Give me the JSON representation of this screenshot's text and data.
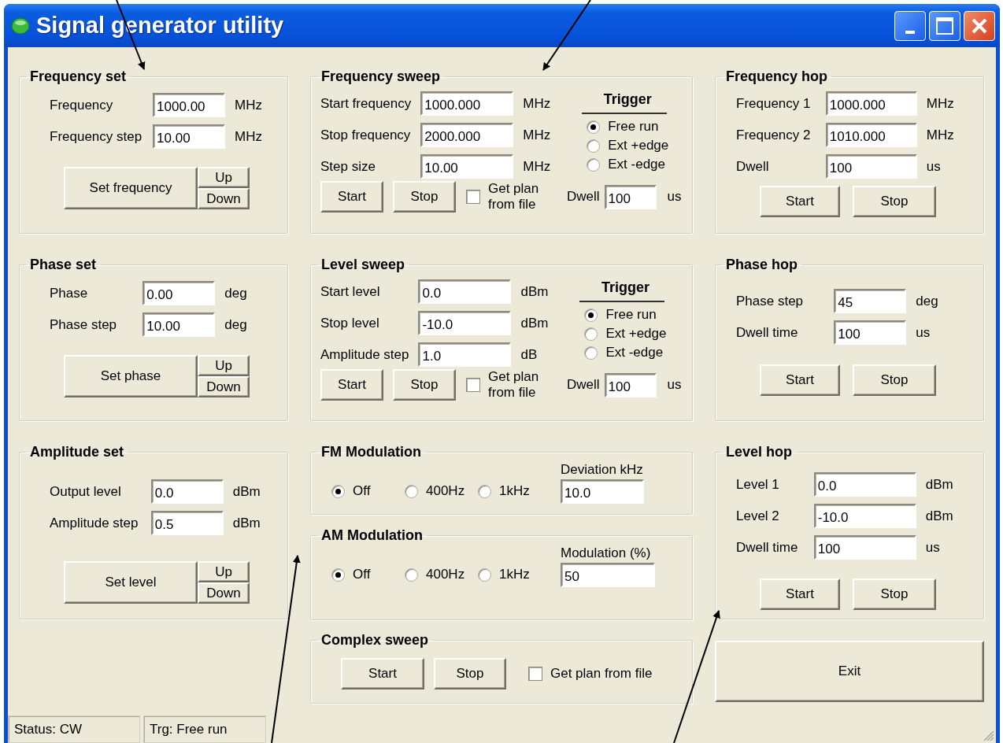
{
  "window": {
    "title": "Signal generator utility"
  },
  "frequency_set": {
    "title": "Frequency set",
    "fields": [
      {
        "label": "Frequency",
        "value": "1000.00",
        "unit": "MHz"
      },
      {
        "label": "Frequency step",
        "value": "10.00",
        "unit": "MHz"
      }
    ],
    "set_button": "Set frequency",
    "up_button": "Up",
    "down_button": "Down"
  },
  "phase_set": {
    "title": "Phase set",
    "fields": [
      {
        "label": "Phase",
        "value": "0.00",
        "unit": "deg"
      },
      {
        "label": "Phase step",
        "value": "10.00",
        "unit": "deg"
      }
    ],
    "set_button": "Set phase",
    "up_button": "Up",
    "down_button": "Down"
  },
  "amplitude_set": {
    "title": "Amplitude set",
    "fields": [
      {
        "label": "Output level",
        "value": "0.0",
        "unit": "dBm"
      },
      {
        "label": "Amplitude step",
        "value": "0.5",
        "unit": "dBm"
      }
    ],
    "set_button": "Set level",
    "up_button": "Up",
    "down_button": "Down"
  },
  "frequency_sweep": {
    "title": "Frequency sweep",
    "fields": [
      {
        "label": "Start frequency",
        "value": "1000.000",
        "unit": "MHz"
      },
      {
        "label": "Stop frequency",
        "value": "2000.000",
        "unit": "MHz"
      },
      {
        "label": "Step size",
        "value": "10.00",
        "unit": "MHz"
      }
    ],
    "trigger": {
      "title": "Trigger",
      "options": [
        {
          "label": "Free run",
          "selected": true
        },
        {
          "label": "Ext +edge",
          "selected": false
        },
        {
          "label": "Ext -edge",
          "selected": false
        }
      ]
    },
    "start_button": "Start",
    "stop_button": "Stop",
    "get_plan": {
      "label": "Get plan from file",
      "checked": false
    },
    "dwell": {
      "label": "Dwell",
      "value": "100",
      "unit": "us"
    }
  },
  "level_sweep": {
    "title": "Level sweep",
    "fields": [
      {
        "label": "Start level",
        "value": "0.0",
        "unit": "dBm"
      },
      {
        "label": "Stop level",
        "value": "-10.0",
        "unit": "dBm"
      },
      {
        "label": "Amplitude step",
        "value": "1.0",
        "unit": "dB"
      }
    ],
    "trigger": {
      "title": "Trigger",
      "options": [
        {
          "label": "Free run",
          "selected": true
        },
        {
          "label": "Ext +edge",
          "selected": false
        },
        {
          "label": "Ext -edge",
          "selected": false
        }
      ]
    },
    "start_button": "Start",
    "stop_button": "Stop",
    "get_plan": {
      "label": "Get plan from file",
      "checked": false
    },
    "dwell": {
      "label": "Dwell",
      "value": "100",
      "unit": "us"
    }
  },
  "fm_modulation": {
    "title": "FM Modulation",
    "options": [
      {
        "label": "Off",
        "selected": true
      },
      {
        "label": "400Hz",
        "selected": false
      },
      {
        "label": "1kHz",
        "selected": false
      }
    ],
    "field": {
      "label": "Deviation kHz",
      "value": "10.0"
    }
  },
  "am_modulation": {
    "title": "AM Modulation",
    "options": [
      {
        "label": "Off",
        "selected": true
      },
      {
        "label": "400Hz",
        "selected": false
      },
      {
        "label": "1kHz",
        "selected": false
      }
    ],
    "field": {
      "label": "Modulation (%)",
      "value": "50"
    }
  },
  "complex_sweep": {
    "title": "Complex sweep",
    "start_button": "Start",
    "stop_button": "Stop",
    "get_plan": {
      "label": "Get plan from file",
      "checked": false
    }
  },
  "frequency_hop": {
    "title": "Frequency hop",
    "fields": [
      {
        "label": "Frequency 1",
        "value": "1000.000",
        "unit": "MHz"
      },
      {
        "label": "Frequency 2",
        "value": "1010.000",
        "unit": "MHz"
      },
      {
        "label": "Dwell",
        "value": "100",
        "unit": "us"
      }
    ],
    "start_button": "Start",
    "stop_button": "Stop"
  },
  "phase_hop": {
    "title": "Phase hop",
    "fields": [
      {
        "label": "Phase step",
        "value": "45",
        "unit": "deg"
      },
      {
        "label": "Dwell time",
        "value": "100",
        "unit": "us"
      }
    ],
    "start_button": "Start",
    "stop_button": "Stop"
  },
  "level_hop": {
    "title": "Level hop",
    "fields": [
      {
        "label": "Level 1",
        "value": "0.0",
        "unit": "dBm"
      },
      {
        "label": "Level 2",
        "value": "-10.0",
        "unit": "dBm"
      },
      {
        "label": "Dwell time",
        "value": "100",
        "unit": "us"
      }
    ],
    "start_button": "Start",
    "stop_button": "Stop"
  },
  "exit_button": "Exit",
  "status_bar": [
    "Status: CW",
    "Trg: Free run"
  ]
}
